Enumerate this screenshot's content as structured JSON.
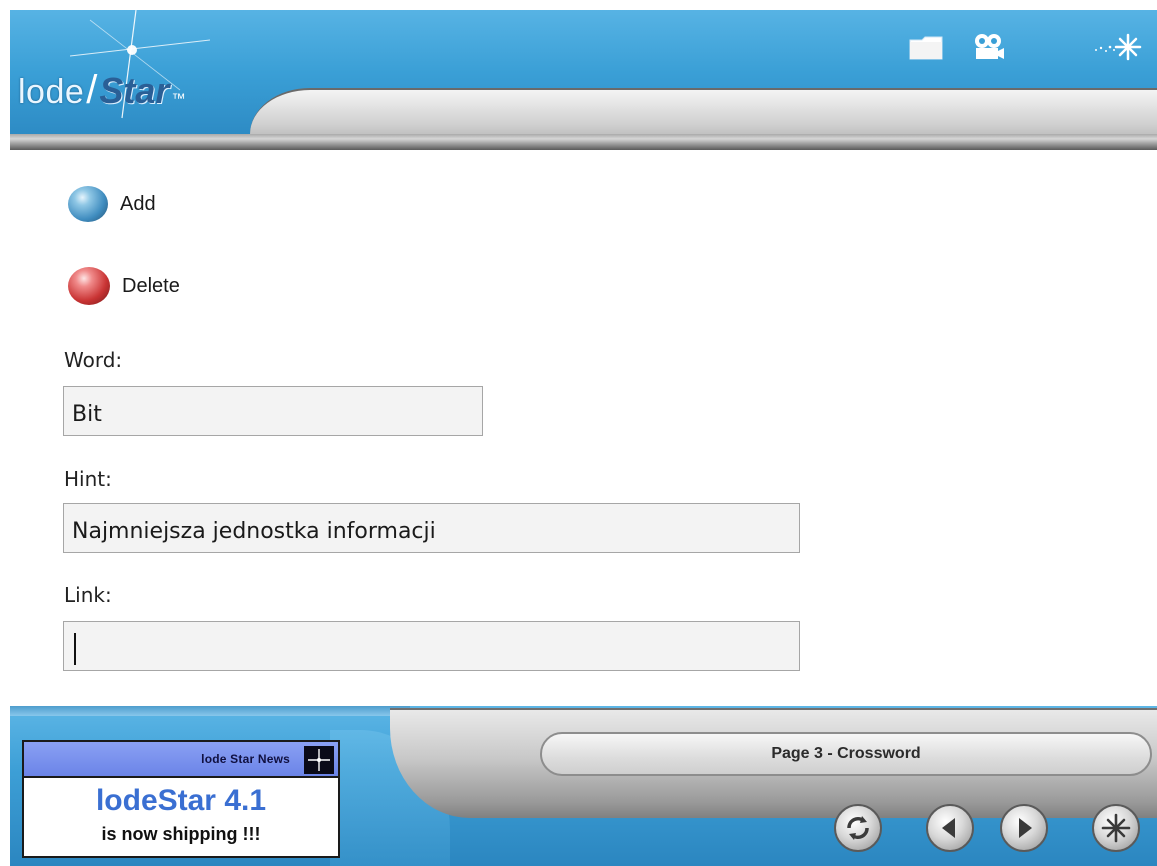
{
  "header": {
    "logo_lode": "lode",
    "logo_slash": "/",
    "logo_star": "Star",
    "logo_tm": "™",
    "icons": [
      "folder-icon",
      "camera-icon",
      "sparkle-star-icon"
    ]
  },
  "actions": {
    "add_label": "Add",
    "delete_label": "Delete"
  },
  "form": {
    "word_label": "Word:",
    "word_value": "Bit",
    "hint_label": "Hint:",
    "hint_value": "Najmniejsza jednostka informacji",
    "link_label": "Link:",
    "link_value": ""
  },
  "footer": {
    "page_title": "Page 3 - Crossword",
    "news": {
      "bar_label": "lode Star News",
      "title": "lodeStar 4.1",
      "subtitle": "is now shipping !!!"
    },
    "nav": [
      "refresh-icon",
      "previous-icon",
      "next-icon",
      "home-star-icon"
    ]
  },
  "colors": {
    "brand_blue": "#3a9fd6",
    "silver": "#c8c8c8",
    "add_button": "#3f8cbf",
    "delete_button": "#c93434",
    "news_title": "#3a6fd2"
  }
}
